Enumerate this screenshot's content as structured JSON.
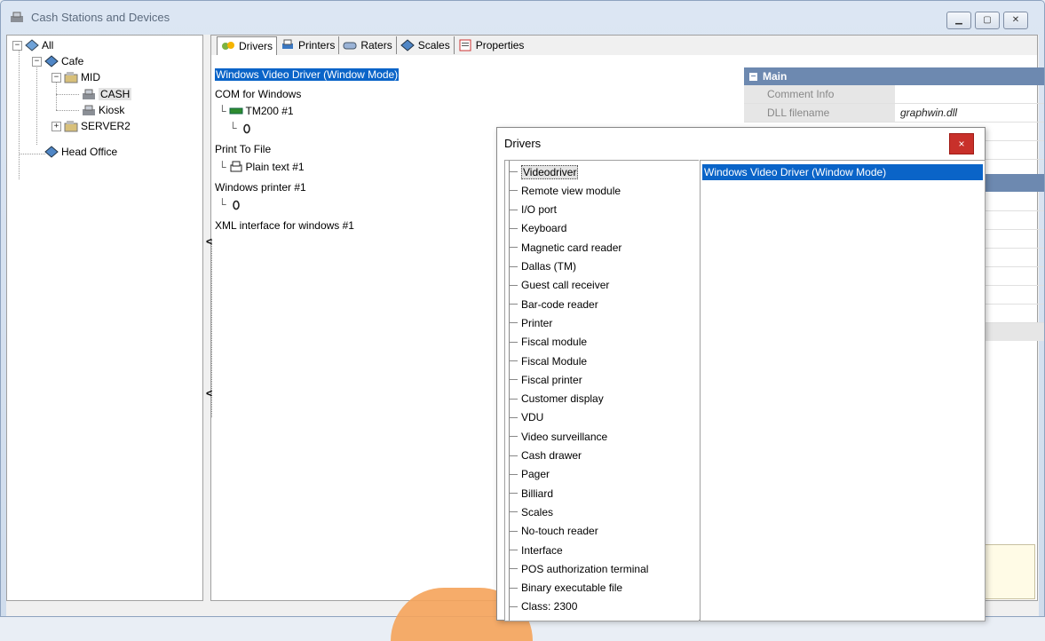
{
  "window": {
    "title": "Cash Stations and Devices",
    "controls": [
      "minimize",
      "maximize",
      "close"
    ]
  },
  "tree": {
    "nodes": [
      {
        "label": "All",
        "icon": "network-icon"
      },
      {
        "label": "Cafe",
        "icon": "group-icon"
      },
      {
        "label": "MID",
        "icon": "folder-icon"
      },
      {
        "label": "CASH",
        "icon": "cash-register-icon"
      },
      {
        "label": "Kiosk",
        "icon": "cash-register-icon"
      },
      {
        "label": "SERVER2",
        "icon": "folder-icon"
      },
      {
        "label": "Head Office",
        "icon": "group-icon"
      }
    ]
  },
  "tabs": [
    {
      "label": "Drivers",
      "icon": "drivers-icon"
    },
    {
      "label": "Printers",
      "icon": "printer-icon"
    },
    {
      "label": "Raters",
      "icon": "rater-icon"
    },
    {
      "label": "Scales",
      "icon": "scales-icon"
    },
    {
      "label": "Properties",
      "icon": "properties-icon"
    }
  ],
  "drivers": [
    {
      "label": "Windows Video Driver (Window Mode)",
      "level": 0,
      "selected": true
    },
    {
      "label": "COM for Windows",
      "level": 0
    },
    {
      "label": "TM200 #1",
      "level": 1,
      "icon": "com-port-icon"
    },
    {
      "label": "",
      "level": 1,
      "icon": "mouse-icon"
    },
    {
      "label": "Print To File",
      "level": 0
    },
    {
      "label": "Plain text #1",
      "level": 1,
      "icon": "printer-icon"
    },
    {
      "label": "Windows printer #1",
      "level": 0
    },
    {
      "label": "",
      "level": 1,
      "icon": "mouse-icon"
    },
    {
      "label": "XML interface for windows #1",
      "level": 0
    }
  ],
  "properties": {
    "section": "Main",
    "rows": [
      {
        "name": "Comment Info",
        "value": ""
      },
      {
        "name": "DLL filename",
        "value": "graphwin.dll"
      }
    ]
  },
  "dialog": {
    "title": "Drivers",
    "classes": [
      "Videodriver",
      "Remote view module",
      "I/O port",
      "Keyboard",
      "Magnetic card reader",
      "Dallas (TM)",
      "Guest call receiver",
      "Bar-code reader",
      "Printer",
      "Fiscal module",
      "Fiscal Module",
      "Fiscal printer",
      "Customer display",
      "VDU",
      "Video surveillance",
      "Cash drawer",
      "Pager",
      "Billiard",
      "Scales",
      "No-touch reader",
      "Interface",
      "POS authorization terminal",
      "Binary executable file",
      "Class: 2300"
    ],
    "selected_class": "Videodriver",
    "drivers": [
      "Windows Video Driver (Window Mode)"
    ]
  },
  "colors": {
    "selection": "#0a64c8",
    "property_header": "#6d89b0",
    "close_button": "#c8302a"
  }
}
